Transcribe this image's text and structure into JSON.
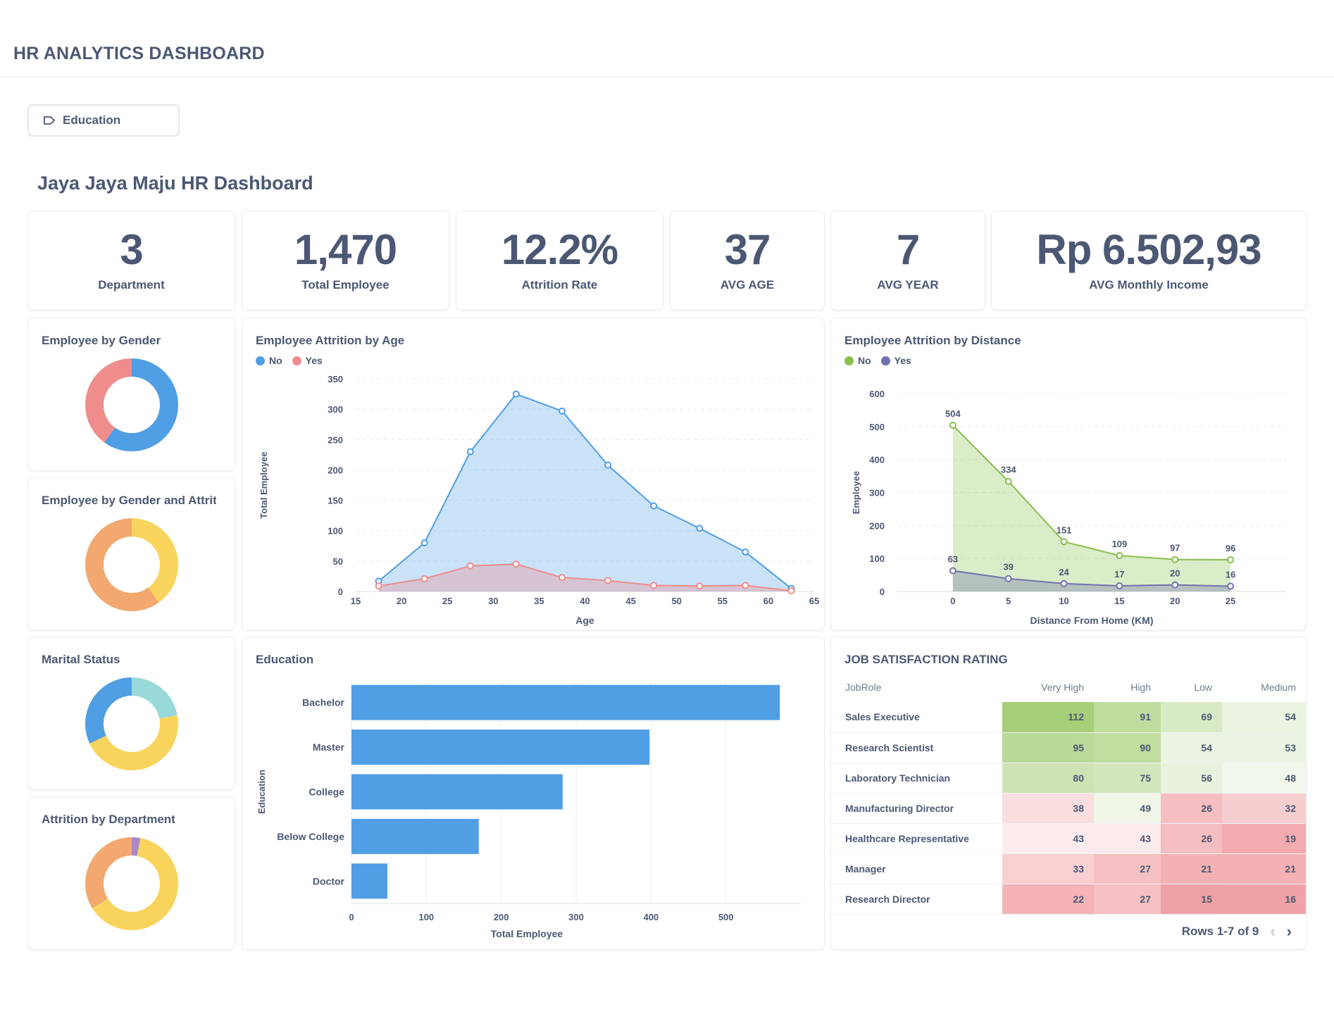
{
  "header": {
    "title": "HR ANALYTICS DASHBOARD"
  },
  "filter": {
    "label": "Education",
    "icon": "tag-icon"
  },
  "dashboard": {
    "title": "Jaya Jaya Maju HR Dashboard"
  },
  "kpis": [
    {
      "value": "3",
      "label": "Department"
    },
    {
      "value": "1,470",
      "label": "Total Employee"
    },
    {
      "value": "12.2%",
      "label": "Attrition Rate"
    },
    {
      "value": "37",
      "label": "AVG AGE"
    },
    {
      "value": "7",
      "label": "AVG YEAR"
    },
    {
      "value": "Rp 6.502,93",
      "label": "AVG Monthly Income"
    }
  ],
  "donut_titles": {
    "gender": "Employee by Gender",
    "gender_attrition": "Employee by Gender and Attrition",
    "marital": "Marital Status",
    "department": "Attrition by Department"
  },
  "chart_data": [
    {
      "type": "pie",
      "title": "Employee by Gender",
      "slices": [
        {
          "value": 0.6,
          "color": "#509ee3"
        },
        {
          "value": 0.4,
          "color": "#ef8c8c"
        }
      ]
    },
    {
      "type": "pie",
      "title": "Employee by Gender and Attrition",
      "slices": [
        {
          "value": 0.4,
          "color": "#f9d45c"
        },
        {
          "value": 0.6,
          "color": "#f2a86f"
        }
      ]
    },
    {
      "type": "pie",
      "title": "Marital Status",
      "slices": [
        {
          "value": 0.22,
          "color": "#98d9d9"
        },
        {
          "value": 0.46,
          "color": "#f9d45c"
        },
        {
          "value": 0.32,
          "color": "#509ee3"
        }
      ]
    },
    {
      "type": "pie",
      "title": "Attrition by Department",
      "slices": [
        {
          "value": 0.03,
          "color": "#a989c5"
        },
        {
          "value": 0.63,
          "color": "#f9d45c"
        },
        {
          "value": 0.34,
          "color": "#f2a86f"
        }
      ]
    },
    {
      "type": "area",
      "title": "Employee Attrition by Age",
      "xlabel": "Age",
      "ylabel": "Total Employee",
      "xlim": [
        15,
        65
      ],
      "ylim": [
        0,
        350
      ],
      "xticks": [
        15,
        20,
        25,
        30,
        35,
        40,
        45,
        50,
        55,
        60,
        65
      ],
      "yticks": [
        0,
        50,
        100,
        150,
        200,
        250,
        300,
        350
      ],
      "x": [
        17.5,
        22.5,
        27.5,
        32.5,
        37.5,
        42.5,
        47.5,
        52.5,
        57.5,
        62.5
      ],
      "series": [
        {
          "name": "No",
          "color": "#509ee3",
          "values": [
            17,
            80,
            230,
            325,
            297,
            208,
            141,
            104,
            65,
            5
          ]
        },
        {
          "name": "Yes",
          "color": "#ef8c8c",
          "values": [
            9,
            21,
            42,
            45,
            23,
            18,
            10,
            9,
            10,
            1
          ]
        }
      ],
      "legend": "top-left"
    },
    {
      "type": "area",
      "title": "Employee Attrition by Distance",
      "xlabel": "Distance From Home (KM)",
      "ylabel": "Employee",
      "xlim": [
        -5,
        30
      ],
      "ylim": [
        0,
        600
      ],
      "xticks": [
        0,
        5,
        10,
        15,
        20,
        25
      ],
      "yticks": [
        0,
        100,
        200,
        300,
        400,
        500,
        600
      ],
      "x": [
        0,
        5,
        10,
        15,
        20,
        25
      ],
      "series": [
        {
          "name": "No",
          "color": "#88bf4d",
          "values": [
            504,
            334,
            151,
            109,
            97,
            96
          ]
        },
        {
          "name": "Yes",
          "color": "#7172ad",
          "values": [
            63,
            39,
            24,
            17,
            20,
            16
          ]
        }
      ],
      "legend": "top-left"
    },
    {
      "type": "bar",
      "title": "Education",
      "orientation": "horizontal",
      "xlabel": "Total Employee",
      "ylabel": "Education",
      "xlim": [
        0,
        600
      ],
      "xticks": [
        0,
        100,
        200,
        300,
        400,
        500
      ],
      "categories": [
        "Bachelor",
        "Master",
        "College",
        "Below College",
        "Doctor"
      ],
      "values": [
        572,
        398,
        282,
        170,
        48
      ],
      "color": "#509ee3"
    },
    {
      "type": "table",
      "title": "JOB SATISFACTION RATING",
      "columns": [
        "JobRole",
        "Very High",
        "High",
        "Low",
        "Medium"
      ],
      "rows": [
        [
          "Sales Executive",
          112,
          91,
          69,
          54
        ],
        [
          "Research Scientist",
          95,
          90,
          54,
          53
        ],
        [
          "Laboratory Technician",
          80,
          75,
          56,
          48
        ],
        [
          "Manufacturing Director",
          38,
          49,
          26,
          32
        ],
        [
          "Healthcare Representative",
          43,
          43,
          26,
          19
        ],
        [
          "Manager",
          33,
          27,
          21,
          21
        ],
        [
          "Research Director",
          22,
          27,
          15,
          16
        ]
      ],
      "pager": "Rows 1-7 of 9"
    }
  ]
}
